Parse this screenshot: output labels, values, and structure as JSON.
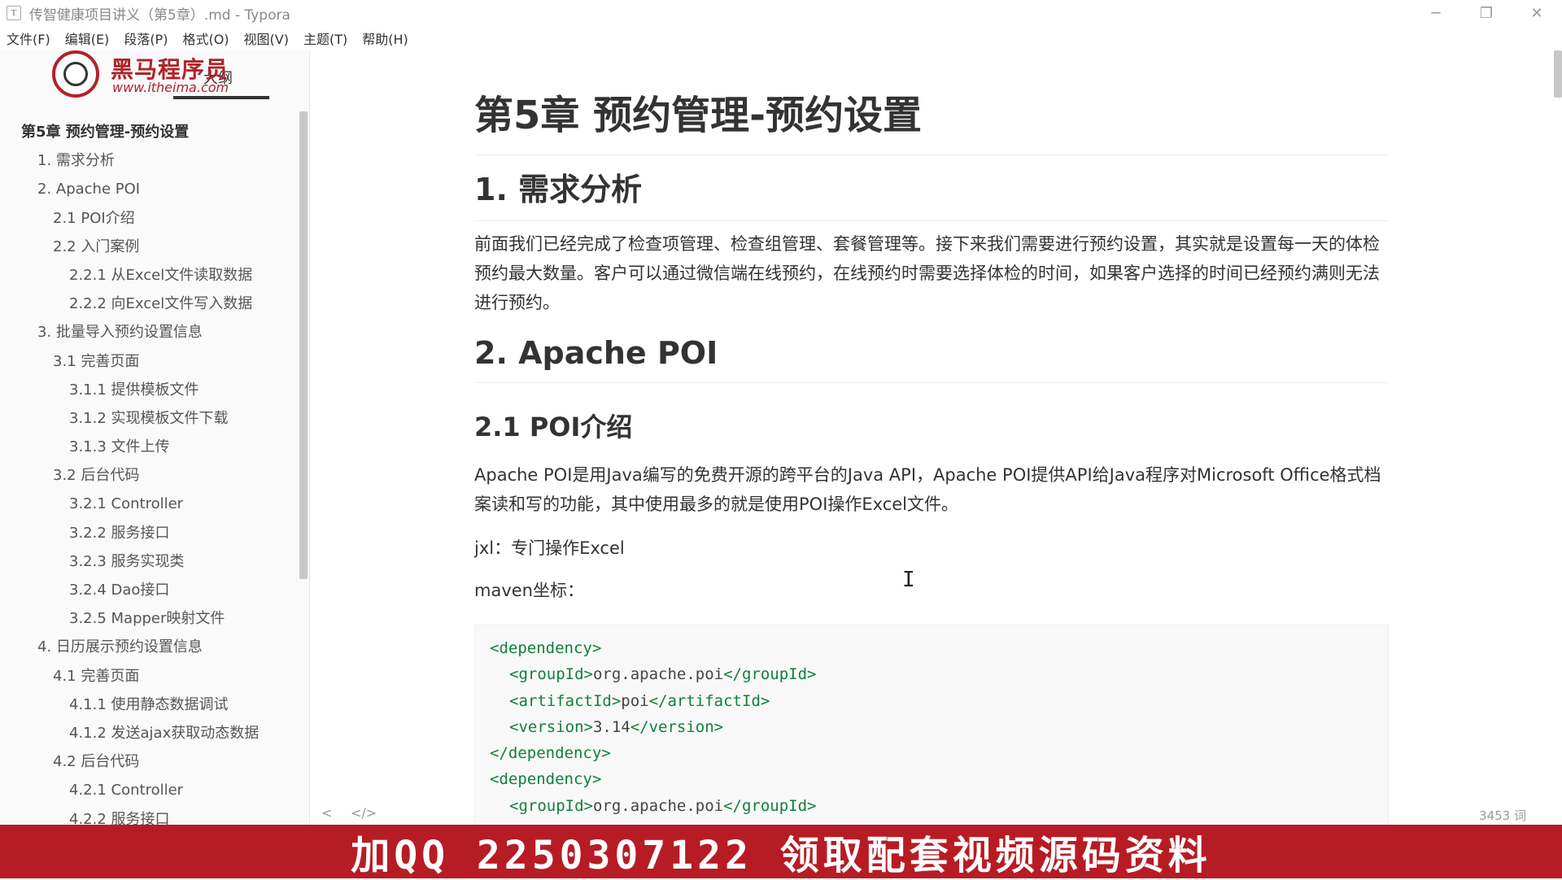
{
  "window": {
    "title": "传智健康项目讲义（第5章）.md - Typora",
    "app_icon": "T",
    "controls": [
      "─",
      "❐",
      "✕"
    ]
  },
  "menu": [
    "文件(F)",
    "编辑(E)",
    "段落(P)",
    "格式(O)",
    "视图(V)",
    "主题(T)",
    "帮助(H)"
  ],
  "logo": {
    "brand": "黑马程序员",
    "url": "www.itheima.com"
  },
  "sidebar": {
    "tab_label": "大纲",
    "outline": [
      {
        "level": 1,
        "label": "第5章 预约管理-预约设置"
      },
      {
        "level": 2,
        "label": "1. 需求分析"
      },
      {
        "level": 2,
        "label": "2. Apache POI"
      },
      {
        "level": 3,
        "label": "2.1 POI介绍"
      },
      {
        "level": 3,
        "label": "2.2 入门案例"
      },
      {
        "level": 4,
        "label": "2.2.1 从Excel文件读取数据"
      },
      {
        "level": 4,
        "label": "2.2.2 向Excel文件写入数据"
      },
      {
        "level": 2,
        "label": "3. 批量导入预约设置信息"
      },
      {
        "level": 3,
        "label": "3.1 完善页面"
      },
      {
        "level": 4,
        "label": "3.1.1 提供模板文件"
      },
      {
        "level": 4,
        "label": "3.1.2 实现模板文件下载"
      },
      {
        "level": 4,
        "label": "3.1.3 文件上传"
      },
      {
        "level": 3,
        "label": "3.2 后台代码"
      },
      {
        "level": 4,
        "label": "3.2.1 Controller"
      },
      {
        "level": 4,
        "label": "3.2.2 服务接口"
      },
      {
        "level": 4,
        "label": "3.2.3 服务实现类"
      },
      {
        "level": 4,
        "label": "3.2.4 Dao接口"
      },
      {
        "level": 4,
        "label": "3.2.5 Mapper映射文件"
      },
      {
        "level": 2,
        "label": "4. 日历展示预约设置信息"
      },
      {
        "level": 3,
        "label": "4.1 完善页面"
      },
      {
        "level": 4,
        "label": "4.1.1 使用静态数据调试"
      },
      {
        "level": 4,
        "label": "4.1.2 发送ajax获取动态数据"
      },
      {
        "level": 3,
        "label": "4.2 后台代码"
      },
      {
        "level": 4,
        "label": "4.2.1 Controller"
      },
      {
        "level": 4,
        "label": "4.2.2 服务接口"
      }
    ]
  },
  "document": {
    "title": "第5章 预约管理-预约设置",
    "h2_requirements": "1. 需求分析",
    "p_requirements": "前面我们已经完成了检查项管理、检查组管理、套餐管理等。接下来我们需要进行预约设置，其实就是设置每一天的体检预约最大数量。客户可以通过微信端在线预约，在线预约时需要选择体检的时间，如果客户选择的时间已经预约满则无法进行预约。",
    "h2_poi": "2. Apache POI",
    "h3_poi_intro": "2.1 POI介绍",
    "p_poi_intro": "Apache POI是用Java编写的免费开源的跨平台的Java API，Apache POI提供API给Java程序对Microsoft Office格式档案读和写的功能，其中使用最多的就是使用POI操作Excel文件。",
    "p_jxl": "jxl：专门操作Excel",
    "p_maven": "maven坐标：",
    "code": [
      {
        "indent": 0,
        "open": "<dependency>",
        "value": "",
        "close": ""
      },
      {
        "indent": 1,
        "open": "<groupId>",
        "value": "org.apache.poi",
        "close": "</groupId>"
      },
      {
        "indent": 1,
        "open": "<artifactId>",
        "value": "poi",
        "close": "</artifactId>"
      },
      {
        "indent": 1,
        "open": "<version>",
        "value": "3.14",
        "close": "</version>"
      },
      {
        "indent": 0,
        "open": "</dependency>",
        "value": "",
        "close": ""
      },
      {
        "indent": 0,
        "open": "<dependency>",
        "value": "",
        "close": ""
      },
      {
        "indent": 1,
        "open": "<groupId>",
        "value": "org.apache.poi",
        "close": "</groupId>"
      }
    ]
  },
  "status": {
    "nav_left": "<",
    "nav_code": "</>",
    "word_count": "3453 词"
  },
  "banner": {
    "text": "加QQ 2250307122 领取配套视频源码资料"
  },
  "colors": {
    "banner_bg": "#b71c24",
    "code_tag": "#11803a",
    "brand_red": "#b0232a"
  }
}
